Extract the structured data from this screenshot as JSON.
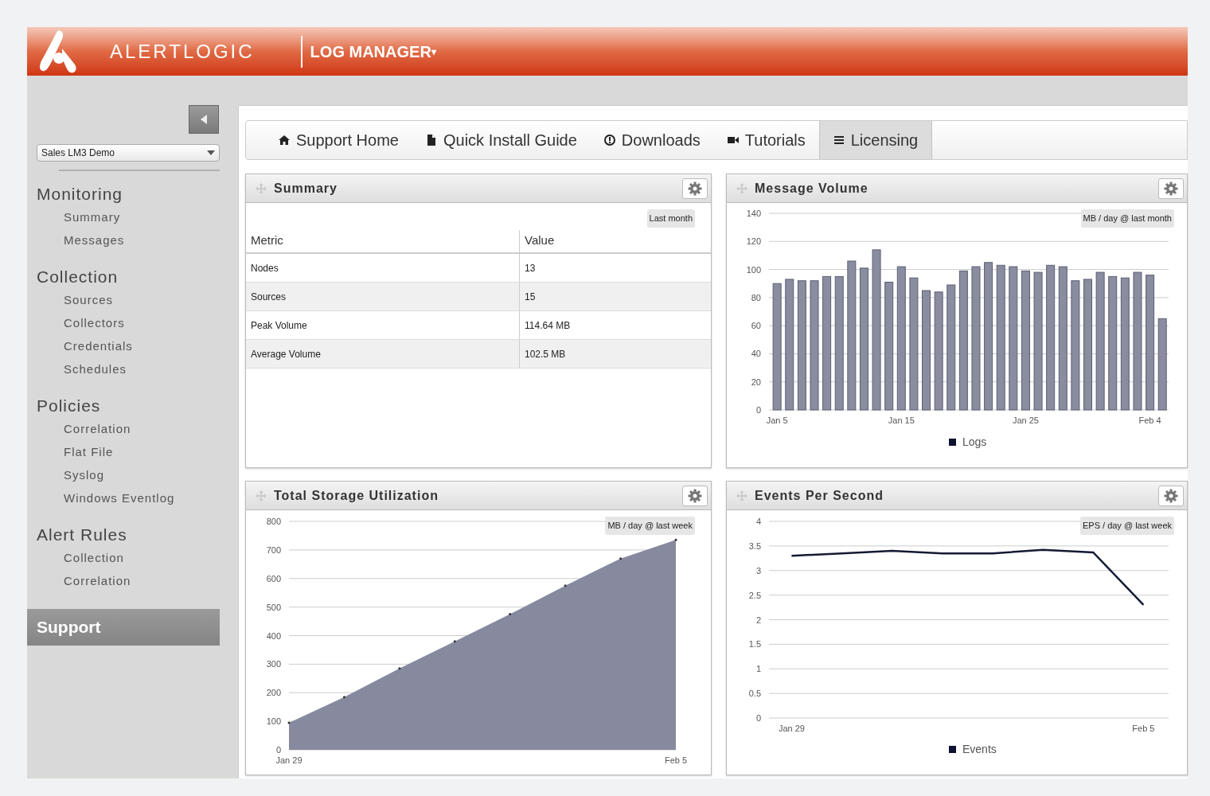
{
  "header": {
    "brand": "ALERTLOGIC",
    "product": "LOG MANAGER",
    "product_caret": "▾"
  },
  "sidebar": {
    "account": {
      "value": "Sales LM3 Demo"
    },
    "sections": [
      {
        "title": "Monitoring",
        "selected": false,
        "items": [
          {
            "label": "Summary"
          },
          {
            "label": "Messages"
          }
        ]
      },
      {
        "title": "Collection",
        "selected": false,
        "items": [
          {
            "label": "Sources"
          },
          {
            "label": "Collectors"
          },
          {
            "label": "Credentials"
          },
          {
            "label": "Schedules"
          }
        ]
      },
      {
        "title": "Policies",
        "selected": false,
        "items": [
          {
            "label": "Correlation"
          },
          {
            "label": "Flat File"
          },
          {
            "label": "Syslog"
          },
          {
            "label": "Windows Eventlog"
          }
        ]
      },
      {
        "title": "Alert Rules",
        "selected": false,
        "items": [
          {
            "label": "Collection"
          },
          {
            "label": "Correlation"
          }
        ]
      },
      {
        "title": "Support",
        "selected": true
      }
    ]
  },
  "tabs": [
    {
      "label": "Support Home",
      "kind": "home",
      "selected": false
    },
    {
      "label": "Quick Install Guide",
      "kind": "file",
      "selected": false
    },
    {
      "label": "Downloads",
      "kind": "circle",
      "selected": false
    },
    {
      "label": "Tutorials",
      "kind": "video",
      "selected": false
    },
    {
      "label": "Licensing",
      "kind": "list",
      "selected": true
    }
  ],
  "summary": {
    "title": "Summary",
    "badge": "Last month",
    "columns": [
      "Metric",
      "Value"
    ],
    "rows": [
      [
        "Nodes",
        "13"
      ],
      [
        "Sources",
        "15"
      ],
      [
        "Peak Volume",
        "114.64 MB"
      ],
      [
        "Average Volume",
        "102.5 MB"
      ]
    ]
  },
  "message_volume": {
    "title": "Message Volume",
    "badge": "MB / day @ last month",
    "chart_data": {
      "type": "bar",
      "grid": true,
      "categories": [
        "Jan 5",
        null,
        null,
        null,
        null,
        null,
        null,
        null,
        null,
        null,
        "Jan 15",
        null,
        null,
        null,
        null,
        null,
        null,
        null,
        null,
        null,
        "Jan 25",
        null,
        null,
        null,
        null,
        null,
        null,
        null,
        null,
        null,
        "Feb 4",
        null
      ],
      "ylim": [
        0,
        140
      ],
      "yticks": [
        0,
        20,
        40,
        60,
        80,
        100,
        120,
        140
      ],
      "series": [
        {
          "name": "Logs",
          "color": "#8a8d9f",
          "values": [
            90,
            93,
            92,
            92,
            95,
            95,
            106,
            101,
            114,
            91,
            102,
            94,
            85,
            84,
            89,
            99,
            102,
            105,
            103,
            102,
            99,
            98,
            103,
            102,
            92,
            93,
            98,
            95,
            94,
            98,
            96,
            65
          ]
        }
      ]
    }
  },
  "storage": {
    "title": "Total Storage Utilization",
    "badge": "MB / day @ last week",
    "chart_data": {
      "type": "area",
      "grid": true,
      "categories": [
        "Jan 29",
        null,
        null,
        null,
        null,
        null,
        null,
        "Feb 5"
      ],
      "ylim": [
        0,
        800
      ],
      "yticks": [
        0,
        100,
        200,
        300,
        400,
        500,
        600,
        700,
        800
      ],
      "series": [
        {
          "color": "#878a9e",
          "values": [
            95,
            185,
            285,
            380,
            475,
            575,
            670,
            735
          ]
        }
      ]
    }
  },
  "eps": {
    "title": "Events Per Second",
    "badge": "EPS / day @ last week",
    "chart_data": {
      "type": "line",
      "grid": true,
      "categories": [
        "Jan 29",
        null,
        null,
        null,
        null,
        null,
        null,
        "Feb 5"
      ],
      "ylim": [
        0,
        4
      ],
      "yticks": [
        0,
        0.5,
        1,
        1.5,
        2,
        2.5,
        3,
        3.5,
        4
      ],
      "series": [
        {
          "name": "Events",
          "color": "#151a33",
          "values": [
            3.3,
            3.35,
            3.4,
            3.35,
            3.35,
            3.42,
            3.37,
            2.3
          ]
        }
      ]
    }
  }
}
